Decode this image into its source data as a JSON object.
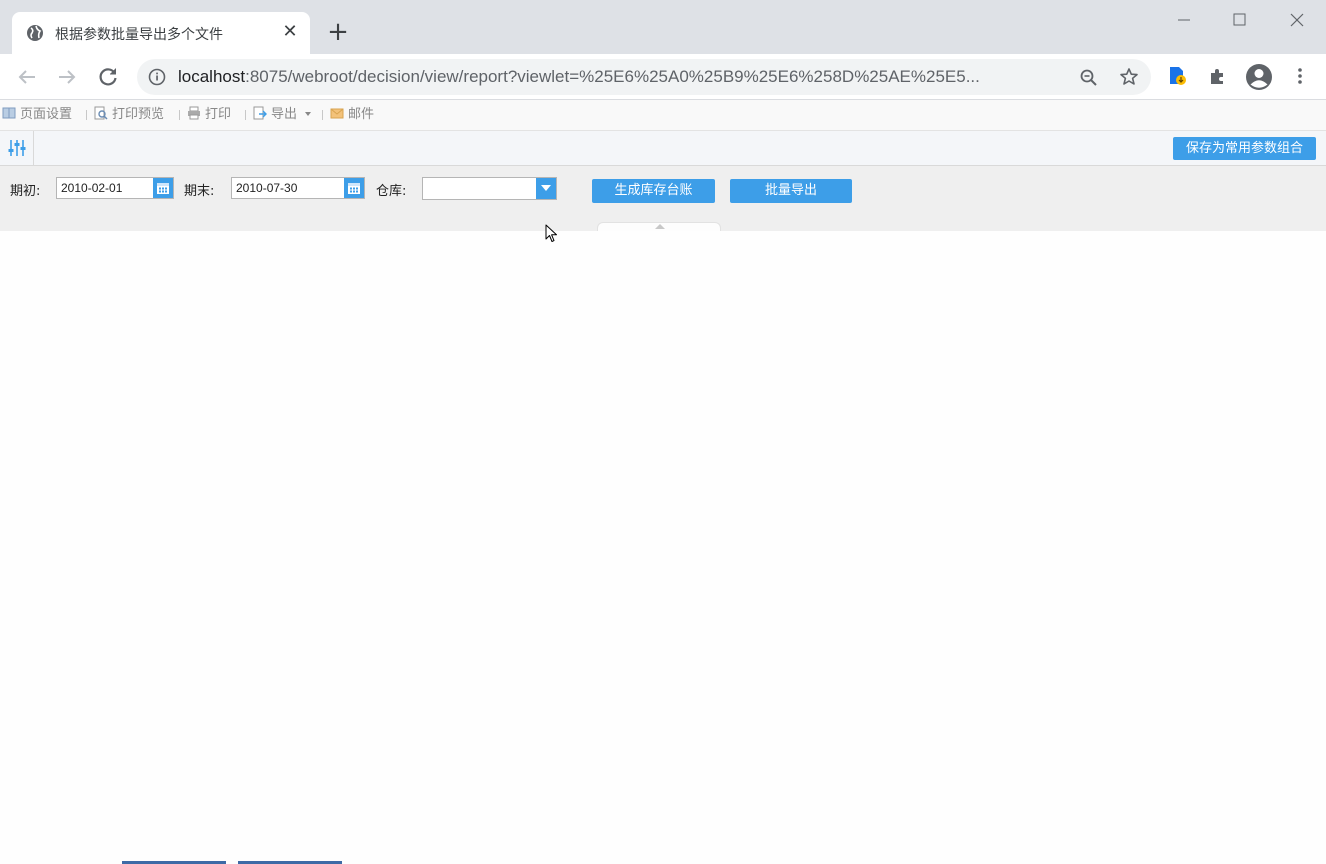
{
  "browser": {
    "tab_title": "根据参数批量导出多个文件",
    "tab_close": "✕",
    "new_tab": "+",
    "url_host": "localhost",
    "url_path": ":8075/webroot/decision/view/report?viewlet=%25E6%25A0%25B9%25E6%258D%25AE%25E5..."
  },
  "report_toolbar": {
    "page_setup": "页面设置",
    "print_preview": "打印预览",
    "print": "打印",
    "export": "导出",
    "mail": "邮件"
  },
  "param_bar": {
    "save_combo_label": "保存为常用参数组合"
  },
  "form": {
    "start_label": "期初:",
    "start_value": "2010-02-01",
    "end_label": "期末:",
    "end_value": "2010-07-30",
    "warehouse_label": "仓库:",
    "warehouse_value": "",
    "generate_button": "生成库存台账",
    "batch_export_button": "批量导出"
  },
  "colors": {
    "accent": "#3d9ee8",
    "chrome_bg": "#dee1e6"
  }
}
